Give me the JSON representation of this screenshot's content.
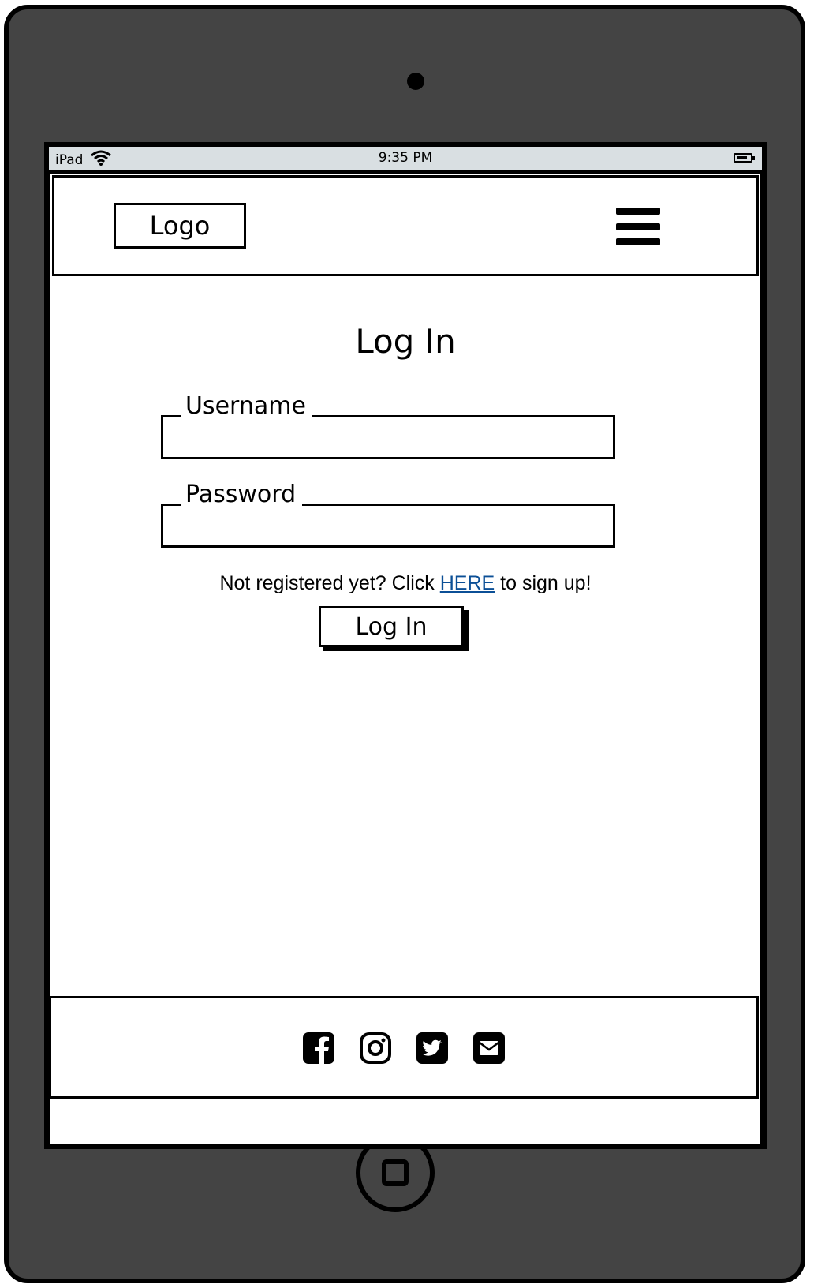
{
  "status_bar": {
    "device": "iPad",
    "time": "9:35 PM"
  },
  "header": {
    "logo": "Logo",
    "menu_icon": "hamburger-menu-icon"
  },
  "main": {
    "title": "Log In",
    "username_label": "Username",
    "password_label": "Password",
    "signup_prefix": "Not registered yet? Click ",
    "signup_link": "HERE",
    "signup_suffix": " to sign up!",
    "login_button": "Log In"
  },
  "footer": {
    "icons": [
      "facebook-icon",
      "instagram-icon",
      "twitter-icon",
      "email-icon"
    ]
  },
  "colors": {
    "device_body": "#444444",
    "status_bar_bg": "#d9dfe2",
    "link": "#0b4f96"
  }
}
